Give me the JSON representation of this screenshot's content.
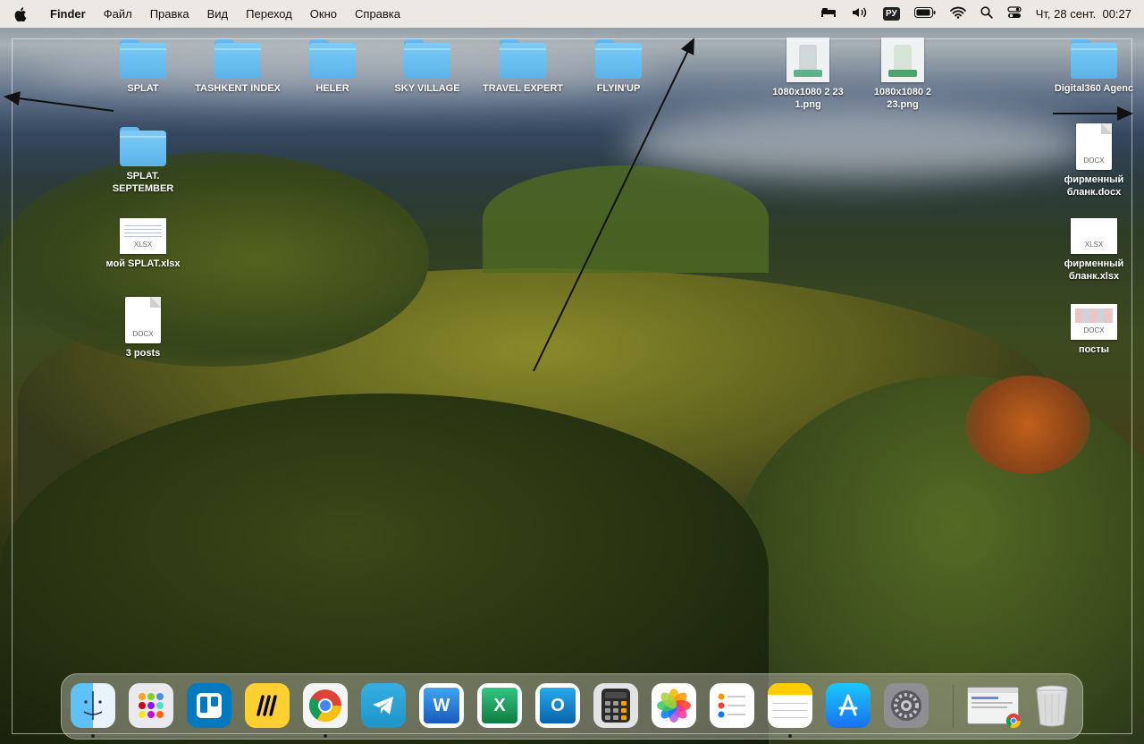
{
  "menubar": {
    "app_name": "Finder",
    "menus": [
      "Файл",
      "Правка",
      "Вид",
      "Переход",
      "Окно",
      "Справка"
    ],
    "input_source": "РУ",
    "datetime": "Чт, 28 сент.  00:27"
  },
  "desktop": {
    "items": [
      {
        "label": "SPLAT",
        "kind": "folder"
      },
      {
        "label": "TASHKENT INDEX",
        "kind": "folder"
      },
      {
        "label": "HELER",
        "kind": "folder"
      },
      {
        "label": "SKY VILLAGE",
        "kind": "folder"
      },
      {
        "label": "TRAVEL EXPERT",
        "kind": "folder"
      },
      {
        "label": "FLYIN'UP",
        "kind": "folder"
      },
      {
        "label": "1080x1080 2 23\n1.png",
        "kind": "image"
      },
      {
        "label": "1080x1080 2\n23.png",
        "kind": "image"
      },
      {
        "label": "Digital360 Agenc",
        "kind": "folder"
      },
      {
        "label": "SPLAT.\nSEPTEMBER",
        "kind": "folder"
      },
      {
        "label": "мой SPLAT.xlsx",
        "kind": "xlsx"
      },
      {
        "label": "3 posts",
        "kind": "docx"
      },
      {
        "label": "фирменный\nбланк.docx",
        "kind": "docx"
      },
      {
        "label": "фирменный\nбланк.xlsx",
        "kind": "xlsx"
      },
      {
        "label": "посты",
        "kind": "docx"
      }
    ],
    "file_ext": {
      "docx": "DOCX",
      "xlsx": "XLSX"
    }
  },
  "dock": {
    "apps": [
      {
        "name": "Finder",
        "icon": "finder-icon",
        "running": true
      },
      {
        "name": "Launchpad",
        "icon": "launchpad-icon",
        "running": false
      },
      {
        "name": "Trello",
        "icon": "trello-icon",
        "running": false
      },
      {
        "name": "Miro",
        "icon": "miro-icon",
        "running": false
      },
      {
        "name": "Google Chrome",
        "icon": "chrome-icon",
        "running": true
      },
      {
        "name": "Telegram",
        "icon": "telegram-icon",
        "running": false
      },
      {
        "name": "Microsoft Word",
        "icon": "word-icon",
        "running": false
      },
      {
        "name": "Microsoft Excel",
        "icon": "excel-icon",
        "running": false
      },
      {
        "name": "Microsoft Outlook",
        "icon": "outlook-icon",
        "running": false
      },
      {
        "name": "Calculator",
        "icon": "calculator-icon",
        "running": false
      },
      {
        "name": "Photos",
        "icon": "photos-icon",
        "running": false
      },
      {
        "name": "Reminders",
        "icon": "reminders-icon",
        "running": false
      },
      {
        "name": "Notes",
        "icon": "notes-icon",
        "running": true
      },
      {
        "name": "App Store",
        "icon": "appstore-icon",
        "running": false
      },
      {
        "name": "System Settings",
        "icon": "settings-icon",
        "running": false
      },
      {
        "name": "Chrome window",
        "icon": "minimized-window-icon",
        "running": false
      },
      {
        "name": "Trash",
        "icon": "trash-icon",
        "running": false
      }
    ],
    "word_letter": "W",
    "excel_letter": "X",
    "outlook_letter": "O"
  },
  "colors": {
    "menubar_bg": "#ece9e4",
    "folder_blue": "#5ab3ea",
    "arrow": "#111111"
  }
}
